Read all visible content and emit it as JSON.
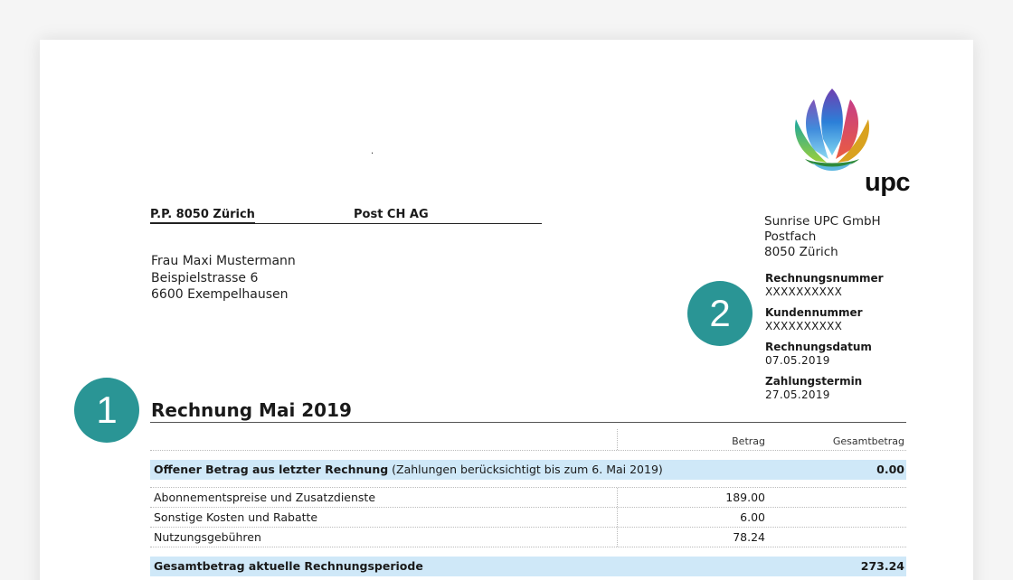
{
  "logo": {
    "text": "upc"
  },
  "pp": {
    "left": "P.P. 8050 Zürich",
    "right": "Post CH AG"
  },
  "dot": ".",
  "recipient": [
    "Frau Maxi Mustermann",
    "Beispielstrasse 6",
    "6600 Exempelhausen"
  ],
  "sender": [
    "Sunrise UPC GmbH",
    "Postfach",
    "8050 Zürich"
  ],
  "meta": [
    {
      "label": "Rechnungsnummer",
      "value": "XXXXXXXXXX"
    },
    {
      "label": "Kundennummer",
      "value": "XXXXXXXXXX"
    },
    {
      "label": "Rechnungsdatum",
      "value": "07.05.2019"
    },
    {
      "label": "Zahlungstermin",
      "value": "27.05.2019"
    }
  ],
  "badges": {
    "one": "1",
    "two": "2"
  },
  "title": "Rechnung Mai 2019",
  "table": {
    "headers": {
      "amount": "Betrag",
      "total": "Gesamtbetrag"
    },
    "open": {
      "label_bold": "Offener Betrag aus letzter Rechnung",
      "label_note": " (Zahlungen berücksichtigt bis zum 6. Mai 2019)",
      "total": "0.00"
    },
    "items": [
      {
        "label": "Abonnementspreise und Zusatzdienste",
        "amount": "189.00"
      },
      {
        "label": "Sonstige Kosten und Rabatte",
        "amount": "6.00"
      },
      {
        "label": "Nutzungsgebühren",
        "amount": "78.24"
      }
    ],
    "sum": {
      "label": "Gesamtbetrag aktuelle Rechnungsperiode",
      "total": "273.24"
    }
  },
  "colors": {
    "accent": "#2a9595",
    "highlight": "#cfe8f8"
  }
}
